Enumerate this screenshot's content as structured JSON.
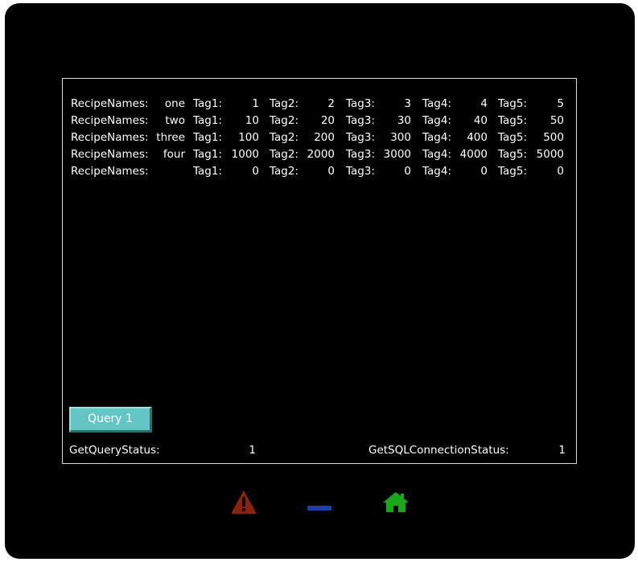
{
  "recipes": [
    {
      "label": "RecipeNames:",
      "name": "one",
      "tags": [
        {
          "label": "Tag1:",
          "value": "1"
        },
        {
          "label": "Tag2:",
          "value": "2"
        },
        {
          "label": "Tag3:",
          "value": "3"
        },
        {
          "label": "Tag4:",
          "value": "4"
        },
        {
          "label": "Tag5:",
          "value": "5"
        }
      ]
    },
    {
      "label": "RecipeNames:",
      "name": "two",
      "tags": [
        {
          "label": "Tag1:",
          "value": "10"
        },
        {
          "label": "Tag2:",
          "value": "20"
        },
        {
          "label": "Tag3:",
          "value": "30"
        },
        {
          "label": "Tag4:",
          "value": "40"
        },
        {
          "label": "Tag5:",
          "value": "50"
        }
      ]
    },
    {
      "label": "RecipeNames:",
      "name": "three",
      "tags": [
        {
          "label": "Tag1:",
          "value": "100"
        },
        {
          "label": "Tag2:",
          "value": "200"
        },
        {
          "label": "Tag3:",
          "value": "300"
        },
        {
          "label": "Tag4:",
          "value": "400"
        },
        {
          "label": "Tag5:",
          "value": "500"
        }
      ]
    },
    {
      "label": "RecipeNames:",
      "name": "four",
      "tags": [
        {
          "label": "Tag1:",
          "value": "1000"
        },
        {
          "label": "Tag2:",
          "value": "2000"
        },
        {
          "label": "Tag3:",
          "value": "3000"
        },
        {
          "label": "Tag4:",
          "value": "4000"
        },
        {
          "label": "Tag5:",
          "value": "5000"
        }
      ]
    },
    {
      "label": "RecipeNames:",
      "name": "",
      "tags": [
        {
          "label": "Tag1:",
          "value": "0"
        },
        {
          "label": "Tag2:",
          "value": "0"
        },
        {
          "label": "Tag3:",
          "value": "0"
        },
        {
          "label": "Tag4:",
          "value": "0"
        },
        {
          "label": "Tag5:",
          "value": "0"
        }
      ]
    }
  ],
  "query_button": {
    "label": "Query 1"
  },
  "status": {
    "query_label": "GetQueryStatus:",
    "query_value": "1",
    "connection_label": "GetSQLConnectionStatus:",
    "connection_value": "1"
  },
  "footer": {
    "alarm_icon": "warning-triangle-icon",
    "alarm_color": "#8b2210",
    "minimize_icon": "minimize-bar-icon",
    "minimize_color": "#1f3fa8",
    "home_icon": "home-icon",
    "home_color": "#1aa81a"
  },
  "colors": {
    "background": "#000000",
    "text": "#ffffff",
    "button": "#64c6c4",
    "screen_border": "#d9d9d9"
  }
}
